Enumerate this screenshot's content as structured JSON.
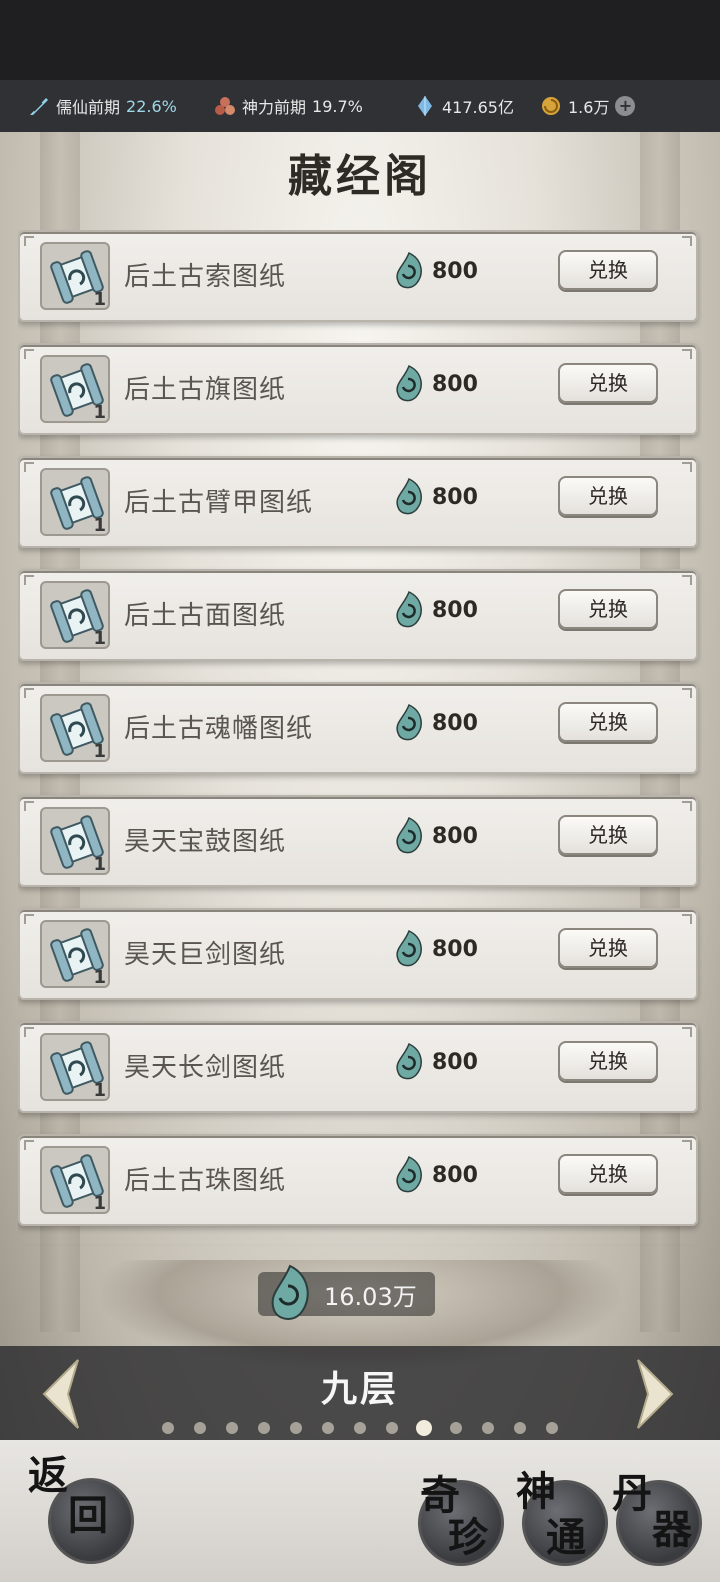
{
  "resources": {
    "cultivation_name": "儒仙前期",
    "cultivation_pct": "22.6%",
    "divine_name": "神力前期",
    "divine_pct": "19.7%",
    "spirit_stones": "417.65亿",
    "currency": "1.6万"
  },
  "page": {
    "title": "藏经阁"
  },
  "items": [
    {
      "name": "后土古索图纸",
      "qty": "1",
      "cost": "800",
      "button": "兑换"
    },
    {
      "name": "后土古旗图纸",
      "qty": "1",
      "cost": "800",
      "button": "兑换"
    },
    {
      "name": "后土古臂甲图纸",
      "qty": "1",
      "cost": "800",
      "button": "兑换"
    },
    {
      "name": "后土古面图纸",
      "qty": "1",
      "cost": "800",
      "button": "兑换"
    },
    {
      "name": "后土古魂幡图纸",
      "qty": "1",
      "cost": "800",
      "button": "兑换"
    },
    {
      "name": "昊天宝鼓图纸",
      "qty": "1",
      "cost": "800",
      "button": "兑换"
    },
    {
      "name": "昊天巨剑图纸",
      "qty": "1",
      "cost": "800",
      "button": "兑换"
    },
    {
      "name": "昊天长剑图纸",
      "qty": "1",
      "cost": "800",
      "button": "兑换"
    },
    {
      "name": "后土古珠图纸",
      "qty": "1",
      "cost": "800",
      "button": "兑换"
    }
  ],
  "balance": "16.03万",
  "floor": {
    "name": "九层",
    "total_pages": 13,
    "active_page": 9
  },
  "bottom_buttons": {
    "back": [
      "返",
      "回"
    ],
    "rare": [
      "奇",
      "珍"
    ],
    "divine": [
      "神",
      "通"
    ],
    "elixir": [
      "丹",
      "器"
    ]
  },
  "colors": {
    "accent": "#9fd7e6",
    "token": "#6fa9a4"
  }
}
